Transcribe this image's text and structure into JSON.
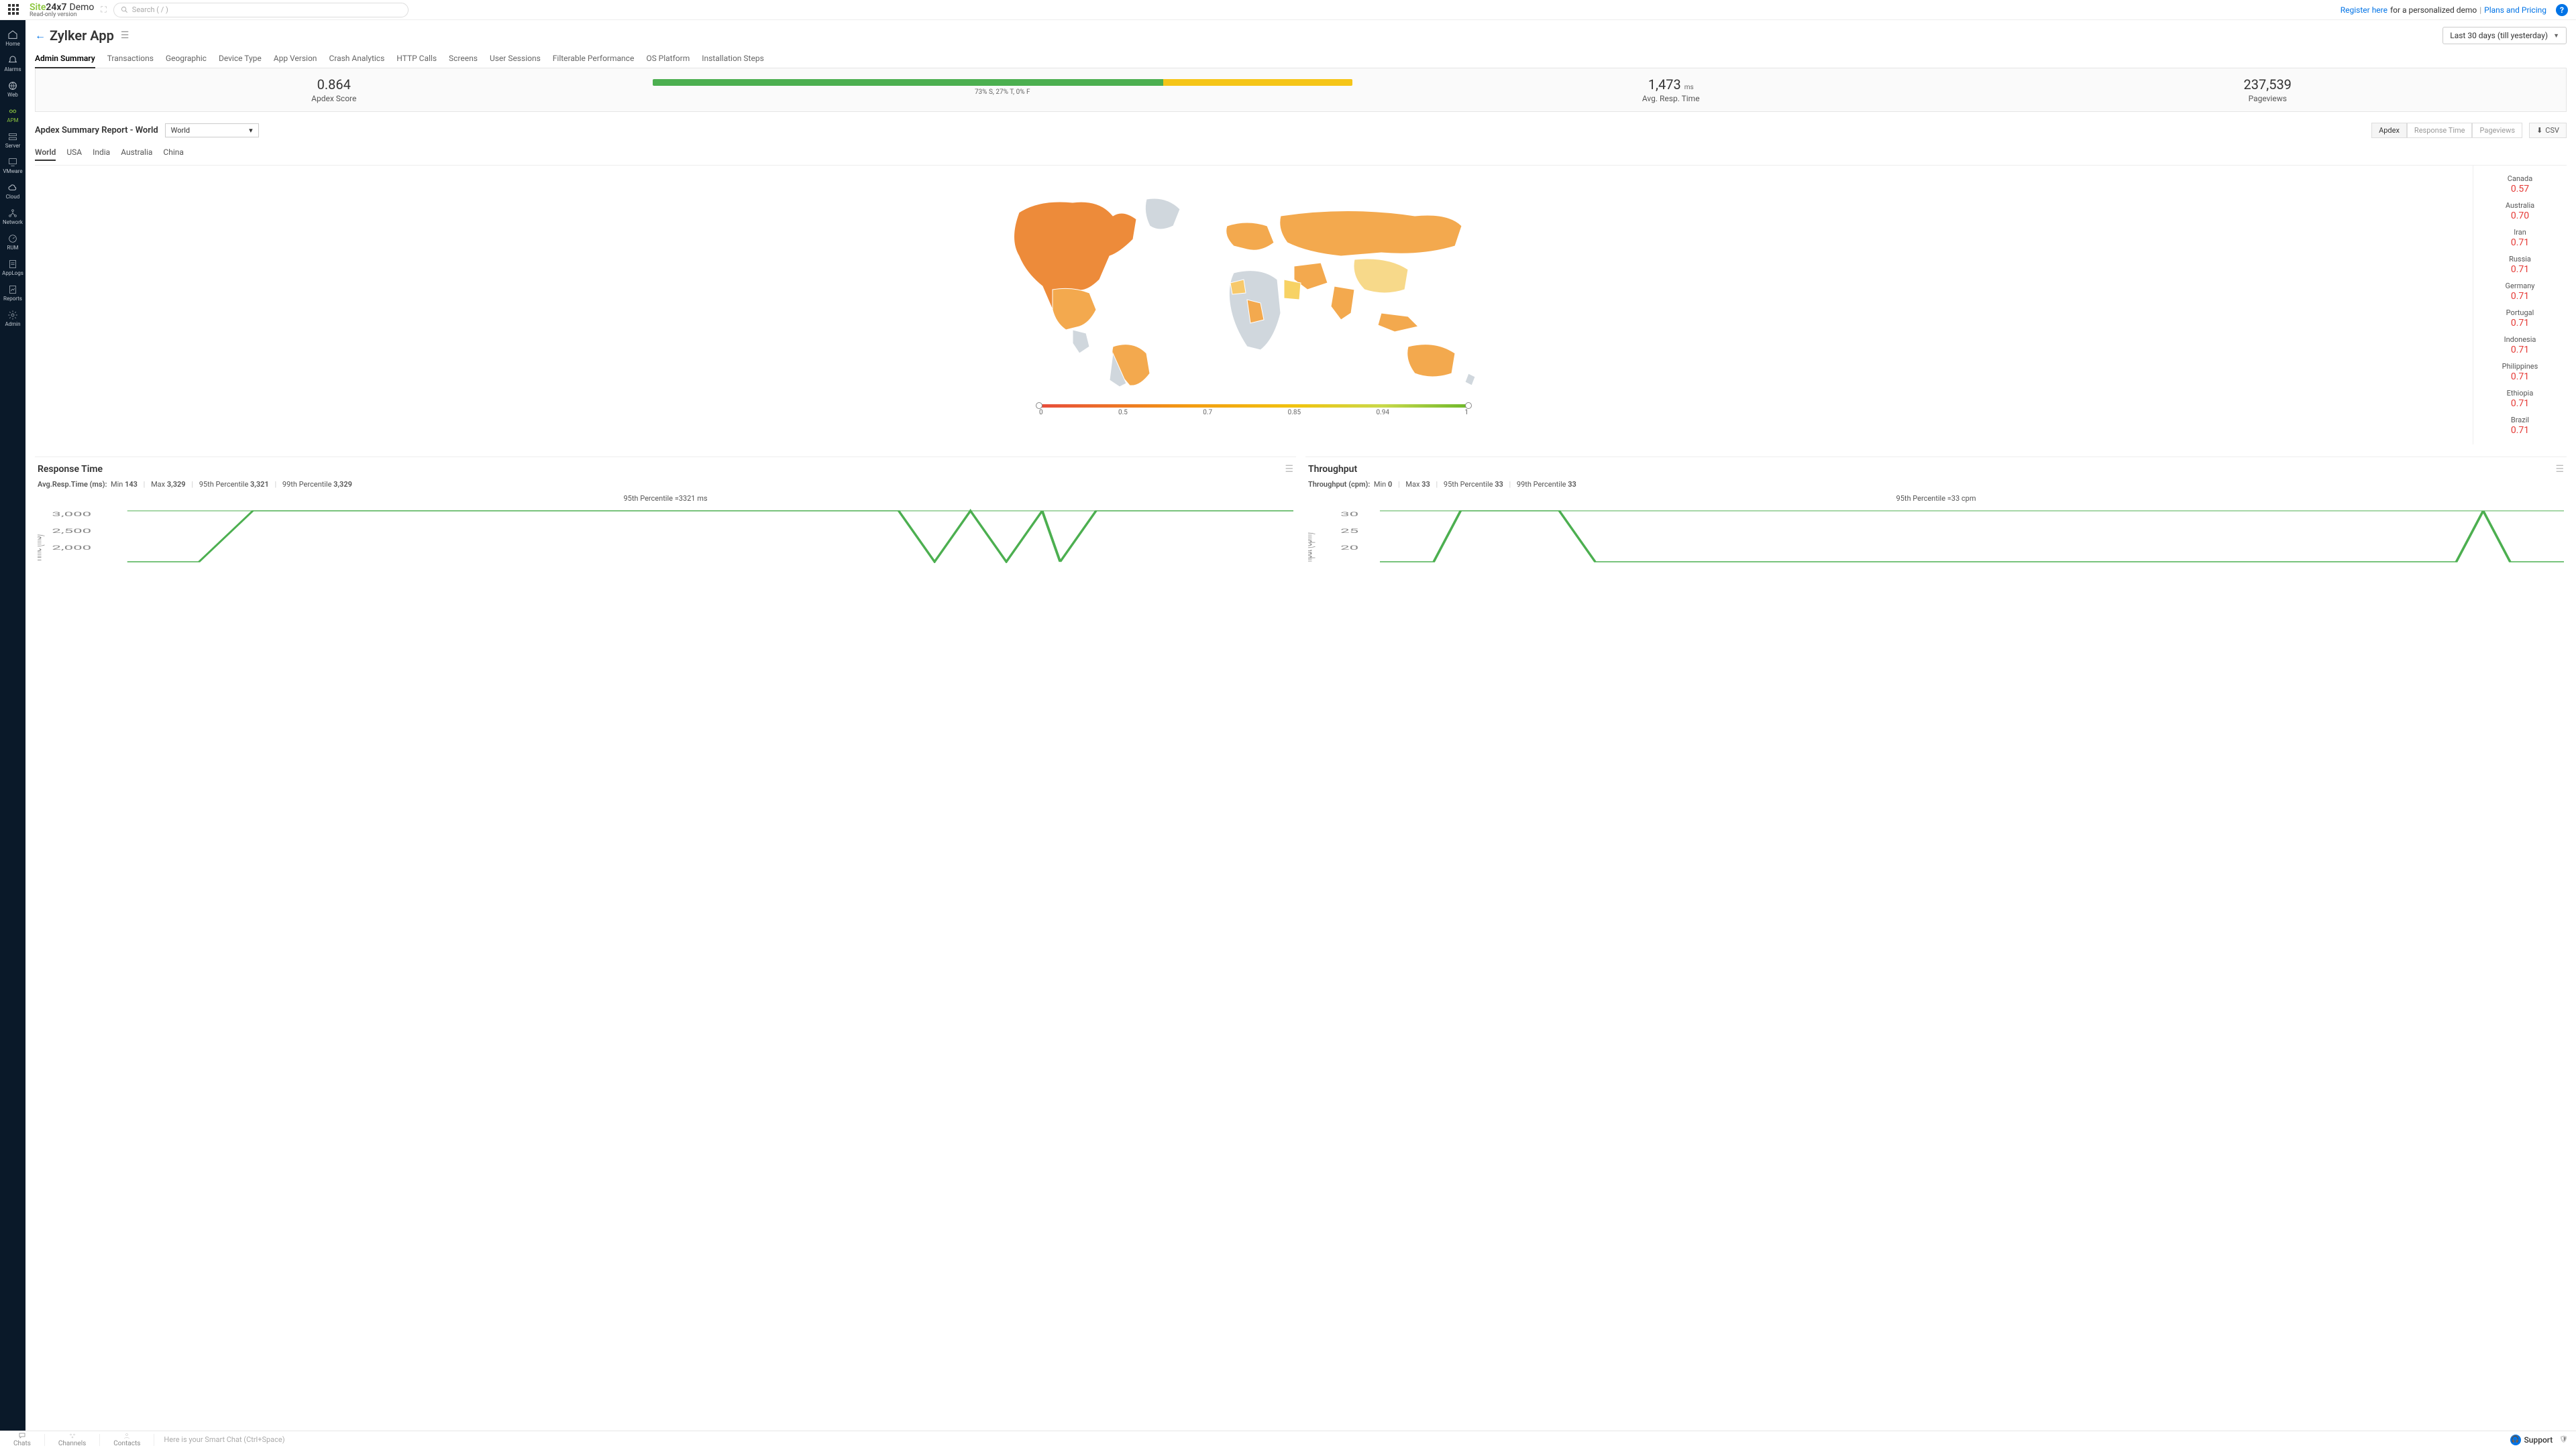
{
  "brand": {
    "site": "Site",
    "x7": "24x7",
    "demo": "Demo",
    "sub": "Read-only version"
  },
  "search": {
    "placeholder": "Search ( / )"
  },
  "topLinks": {
    "register": "Register here",
    "registerSuffix": " for a personalized demo ",
    "sep": "|",
    "plans": "Plans and Pricing"
  },
  "sidebar": [
    {
      "id": "home",
      "label": "Home"
    },
    {
      "id": "alarms",
      "label": "Alarms"
    },
    {
      "id": "web",
      "label": "Web"
    },
    {
      "id": "apm",
      "label": "APM",
      "active": true
    },
    {
      "id": "server",
      "label": "Server"
    },
    {
      "id": "vmware",
      "label": "VMware"
    },
    {
      "id": "cloud",
      "label": "Cloud"
    },
    {
      "id": "network",
      "label": "Network"
    },
    {
      "id": "rum",
      "label": "RUM"
    },
    {
      "id": "applogs",
      "label": "AppLogs"
    },
    {
      "id": "reports",
      "label": "Reports"
    },
    {
      "id": "admin",
      "label": "Admin"
    }
  ],
  "page": {
    "title": "Zylker App",
    "timeRange": "Last 30 days (till yesterday)"
  },
  "tabs": [
    "Admin Summary",
    "Transactions",
    "Geographic",
    "Device Type",
    "App Version",
    "Crash Analytics",
    "HTTP Calls",
    "Screens",
    "User Sessions",
    "Filterable Performance",
    "OS Platform",
    "Installation Steps"
  ],
  "activeTab": 0,
  "kpi": {
    "apdex": {
      "value": "0.864",
      "label": "Apdex Score"
    },
    "bar": {
      "s": 73,
      "t": 27,
      "f": 0,
      "caption": "73% S, 27% T, 0% F"
    },
    "respTime": {
      "value": "1,473",
      "unit": "ms",
      "label": "Avg. Resp. Time"
    },
    "pageviews": {
      "value": "237,539",
      "label": "Pageviews"
    }
  },
  "report": {
    "title": "Apdex Summary Report - World",
    "regionSelected": "World",
    "toggles": [
      "Apdex",
      "Response Time",
      "Pageviews"
    ],
    "csv": "CSV",
    "subtabs": [
      "World",
      "USA",
      "India",
      "Australia",
      "China"
    ],
    "legendTicks": [
      "0",
      "0.5",
      "0.7",
      "0.85",
      "0.94",
      "1"
    ],
    "countries": [
      {
        "name": "Canada",
        "value": "0.57"
      },
      {
        "name": "Australia",
        "value": "0.70"
      },
      {
        "name": "Iran",
        "value": "0.71"
      },
      {
        "name": "Russia",
        "value": "0.71"
      },
      {
        "name": "Germany",
        "value": "0.71"
      },
      {
        "name": "Portugal",
        "value": "0.71"
      },
      {
        "name": "Indonesia",
        "value": "0.71"
      },
      {
        "name": "Philippines",
        "value": "0.71"
      },
      {
        "name": "Ethiopia",
        "value": "0.71"
      },
      {
        "name": "Brazil",
        "value": "0.71"
      }
    ]
  },
  "charts": {
    "responseTime": {
      "title": "Response Time",
      "statsLabel": "Avg.Resp.Time (ms):",
      "min": {
        "label": "Min",
        "value": "143"
      },
      "max": {
        "label": "Max",
        "value": "3,329"
      },
      "p95": {
        "label": "95th Percentile",
        "value": "3,321"
      },
      "p99": {
        "label": "99th Percentile",
        "value": "3,329"
      },
      "percentileAnnotation": "95th Percentile =3321 ms",
      "yTicks": [
        "3,000",
        "2,500",
        "2,000"
      ],
      "yAxisTitle": "Time (ms)"
    },
    "throughput": {
      "title": "Throughput",
      "statsLabel": "Throughput (cpm):",
      "min": {
        "label": "Min",
        "value": "0"
      },
      "max": {
        "label": "Max",
        "value": "33"
      },
      "p95": {
        "label": "95th Percentile",
        "value": "33"
      },
      "p99": {
        "label": "99th Percentile",
        "value": "33"
      },
      "percentileAnnotation": "95th Percentile =33 cpm",
      "yTicks": [
        "30",
        "25",
        "20"
      ],
      "yAxisTitle": "hput (cpm)"
    }
  },
  "bottombar": {
    "chats": "Chats",
    "channels": "Channels",
    "contacts": "Contacts",
    "smartchat": "Here is your Smart Chat (Ctrl+Space)",
    "support": "Support"
  },
  "chart_data": [
    {
      "type": "line",
      "title": "Response Time",
      "ylabel": "Time (ms)",
      "ylim": [
        0,
        3500
      ],
      "annotation": "95th Percentile = 3321 ms",
      "stats": {
        "min": 143,
        "max": 3329,
        "p95": 3321,
        "p99": 3329
      },
      "values": [
        150,
        150,
        3321,
        3321,
        3321,
        3321,
        3321,
        3321,
        3321,
        3321,
        3321,
        3321,
        3321,
        3321,
        3321,
        3321,
        3321,
        3321,
        3321,
        3321,
        150,
        150,
        3321,
        150,
        3321,
        3321,
        150,
        3321,
        3321,
        3321
      ]
    },
    {
      "type": "line",
      "title": "Throughput",
      "ylabel": "Throughput (cpm)",
      "ylim": [
        0,
        35
      ],
      "annotation": "95th Percentile = 33 cpm",
      "stats": {
        "min": 0,
        "max": 33,
        "p95": 33,
        "p99": 33
      },
      "values": [
        0,
        0,
        33,
        33,
        33,
        0,
        0,
        0,
        0,
        0,
        0,
        0,
        0,
        0,
        0,
        0,
        0,
        0,
        0,
        0,
        0,
        0,
        0,
        0,
        0,
        0,
        0,
        0,
        33,
        0
      ]
    },
    {
      "type": "choropleth",
      "title": "Apdex Summary Report - World",
      "scale": [
        0,
        0.5,
        0.7,
        0.85,
        0.94,
        1
      ],
      "data": {
        "Canada": 0.57,
        "Australia": 0.7,
        "Iran": 0.71,
        "Russia": 0.71,
        "Germany": 0.71,
        "Portugal": 0.71,
        "Indonesia": 0.71,
        "Philippines": 0.71,
        "Ethiopia": 0.71,
        "Brazil": 0.71
      }
    }
  ]
}
